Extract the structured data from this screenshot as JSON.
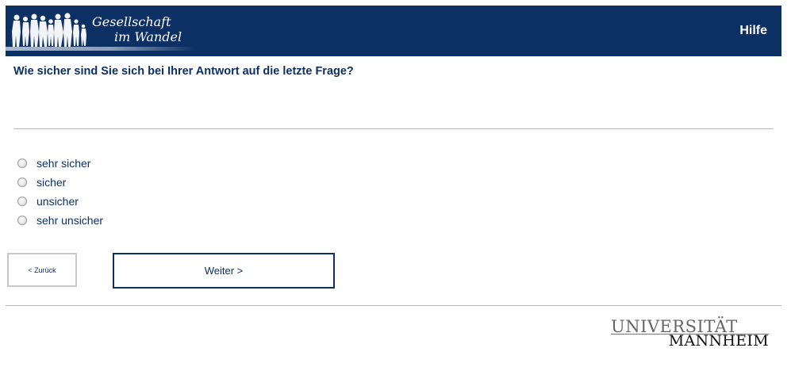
{
  "header": {
    "logo_line1": "Gesellschaft",
    "logo_line2": "im Wandel",
    "help_label": "Hilfe",
    "background_color": "#0c2f64"
  },
  "question": {
    "text": "Wie sicher sind Sie sich bei Ihrer Antwort auf die letzte Frage?"
  },
  "options": [
    {
      "label": "sehr sicher"
    },
    {
      "label": "sicher"
    },
    {
      "label": "unsicher"
    },
    {
      "label": "sehr unsicher"
    }
  ],
  "navigation": {
    "back_label": "< Zurück",
    "next_label": "Weiter >"
  },
  "footer": {
    "university_line1": "UNIVERSITÄT",
    "university_line2": "MANNHEIM"
  }
}
